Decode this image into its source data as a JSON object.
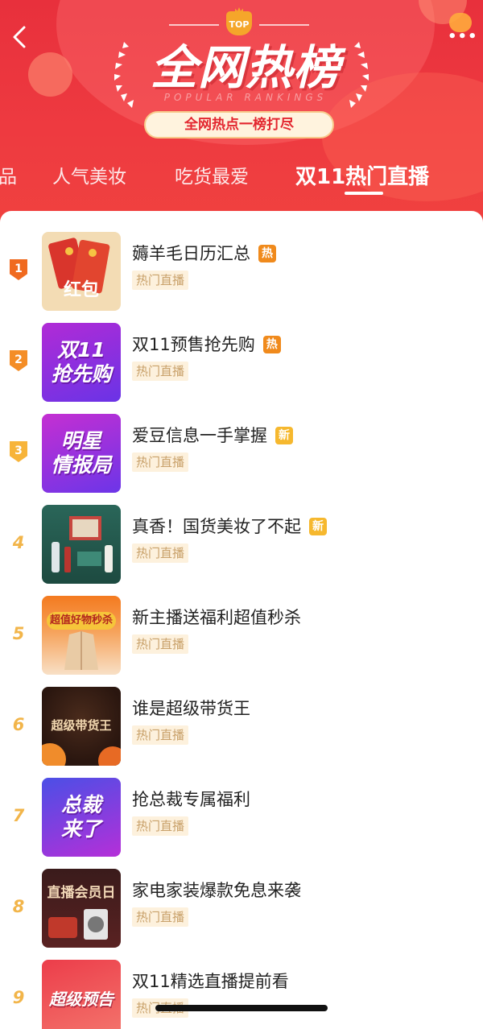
{
  "header": {
    "back_icon": "chevron-left-icon",
    "more_icon": "more-dots-icon",
    "top_badge": "TOP",
    "title": "全网热榜",
    "subtitle_en": "POPULAR RANKINGS",
    "slogan": "全网热点一榜打尽"
  },
  "tabs": [
    {
      "label": "品",
      "active": false
    },
    {
      "label": "人气美妆",
      "active": false
    },
    {
      "label": "吃货最爱",
      "active": false
    },
    {
      "label": "双11热门直播",
      "active": true
    }
  ],
  "list": [
    {
      "rank": "1",
      "title": "薅羊毛日历汇总",
      "badge": "热",
      "tag": "热门直播",
      "thumb_text": "红包"
    },
    {
      "rank": "2",
      "title": "双11预售抢先购",
      "badge": "热",
      "tag": "热门直播",
      "thumb_text": "双11\n抢先购"
    },
    {
      "rank": "3",
      "title": "爱豆信息一手掌握",
      "badge": "新",
      "tag": "热门直播",
      "thumb_text": "明星\n情报局"
    },
    {
      "rank": "4",
      "title": "真香！国货美妆了不起",
      "badge": "新",
      "tag": "热门直播",
      "thumb_text": ""
    },
    {
      "rank": "5",
      "title": "新主播送福利超值秒杀",
      "badge": "",
      "tag": "热门直播",
      "thumb_text": "超值好物秒杀"
    },
    {
      "rank": "6",
      "title": "谁是超级带货王",
      "badge": "",
      "tag": "热门直播",
      "thumb_text": "超级带货王"
    },
    {
      "rank": "7",
      "title": "抢总裁专属福利",
      "badge": "",
      "tag": "热门直播",
      "thumb_text": "总裁\n来了"
    },
    {
      "rank": "8",
      "title": "家电家装爆款免息来袭",
      "badge": "",
      "tag": "热门直播",
      "thumb_text": "直播会员日"
    },
    {
      "rank": "9",
      "title": "双11精选直播提前看",
      "badge": "",
      "tag": "热门直播",
      "thumb_text": "超级预告"
    }
  ],
  "colors": {
    "header_red": "#ec363e",
    "hot_badge": "#f08a1c",
    "new_badge": "#f6b82e",
    "rank1": "#f06a1f",
    "rank2": "#f48d26",
    "rank3": "#f7b43a",
    "rank_plain": "#f2b54a",
    "tag_bg": "#fdf1dd",
    "tag_text": "#c8a069"
  }
}
